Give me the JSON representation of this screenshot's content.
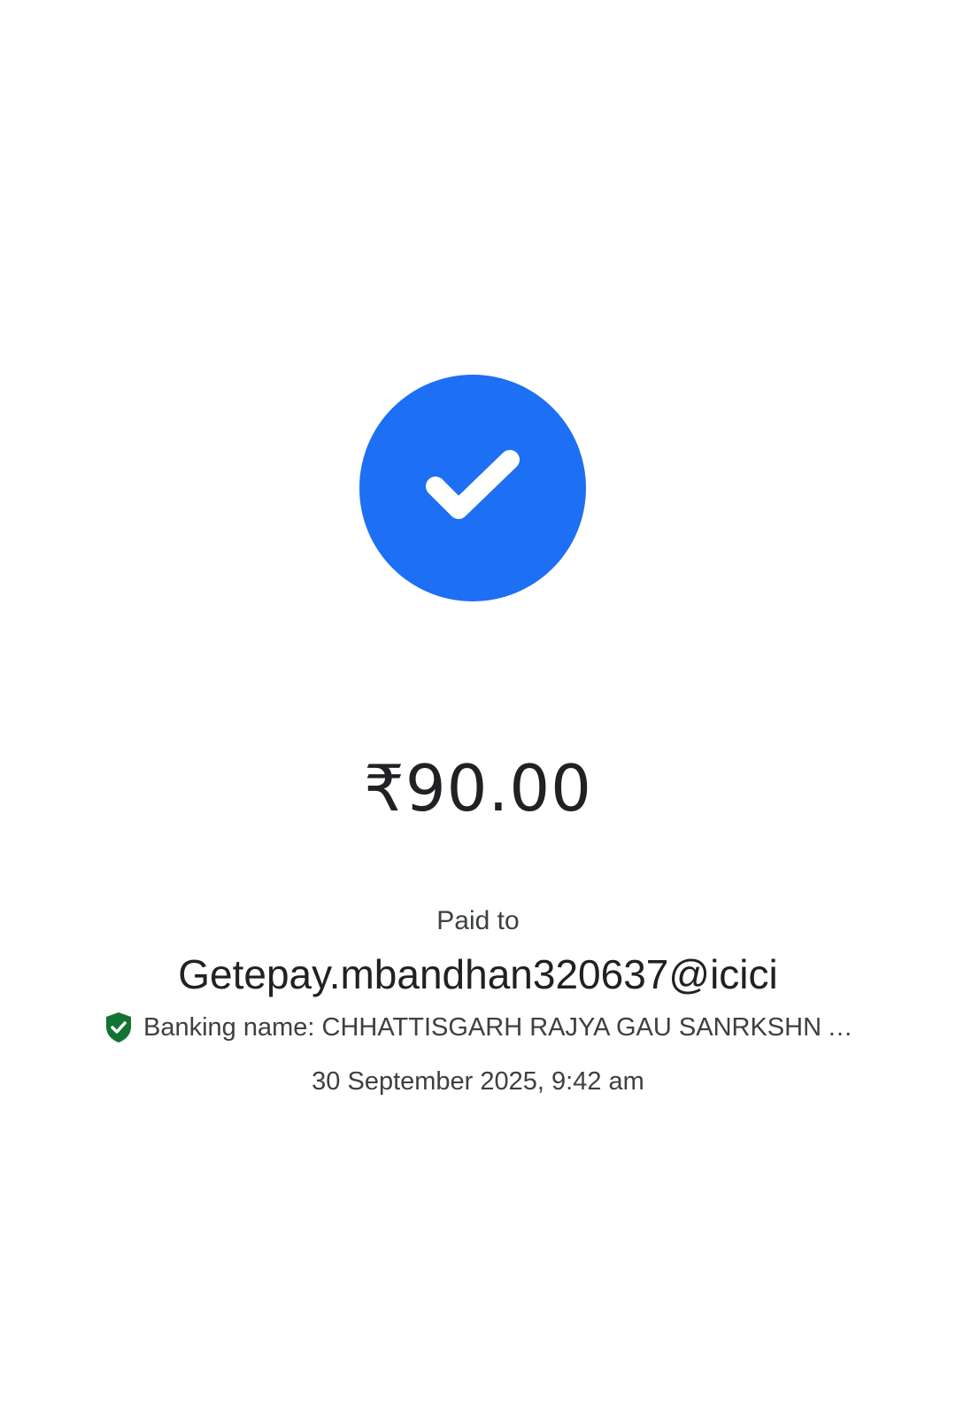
{
  "status": {
    "icon": "check-circle-icon",
    "color": "#1d6ff3"
  },
  "payment": {
    "amount": "₹90.00",
    "paid_to_label": "Paid to",
    "payee_id": "Getepay.mbandhan320637@icici",
    "banking_name": "Banking name: CHHATTISGARH RAJYA GAU SANRKSHN AV...",
    "verified_icon": "verified-shield-icon",
    "verified_color": "#137333",
    "timestamp": "30 September 2025, 9:42 am"
  }
}
